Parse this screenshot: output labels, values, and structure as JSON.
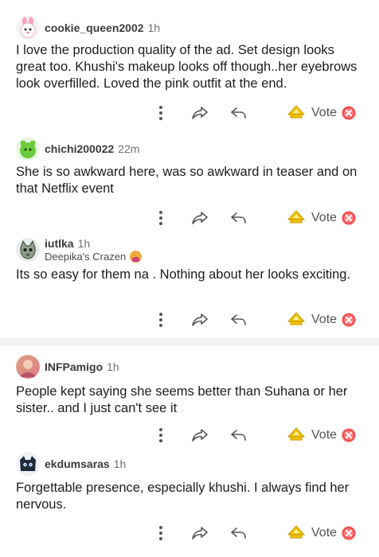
{
  "comments": [
    {
      "username": "cookie_queen2002",
      "time": "1h",
      "flair": "",
      "avatar": "bunny-avatar",
      "text": "I love the production quality of the ad. Set design looks great too. Khushi's makeup looks off though..her eyebrows look overfilled. Loved the pink outfit at the end."
    },
    {
      "username": "chichi200022",
      "time": "22m",
      "flair": "",
      "avatar": "green-blob-avatar",
      "text": "She is so awkward here, was so awkward in teaser and on that Netflix event"
    },
    {
      "username": "iutlka",
      "time": "1h",
      "flair": "Deepika's Crazen",
      "avatar": "cat-avatar",
      "text": "Its so easy for them na . Nothing about her looks exciting."
    },
    {
      "username": "INFPamigo",
      "time": "1h",
      "flair": "",
      "avatar": "photo-avatar",
      "text": "People kept saying she seems better than Suhana or her sister.. and I just can't see it"
    },
    {
      "username": "ekdumsaras",
      "time": "1h",
      "flair": "",
      "avatar": "dark-creature-avatar",
      "text": "Forgettable presence, especially khushi. I always find her nervous."
    }
  ],
  "actions": {
    "vote_label": "Vote",
    "more_icon": "more-vertical-icon",
    "share_icon": "share-arrow-icon",
    "reply_icon": "reply-arrow-icon",
    "upvote_icon": "upvote-award-icon",
    "downvote_icon": "red-x-icon"
  },
  "colors": {
    "upvote": "#e8b820",
    "downvote": "#f05252",
    "divider": "#f1f1f3"
  }
}
